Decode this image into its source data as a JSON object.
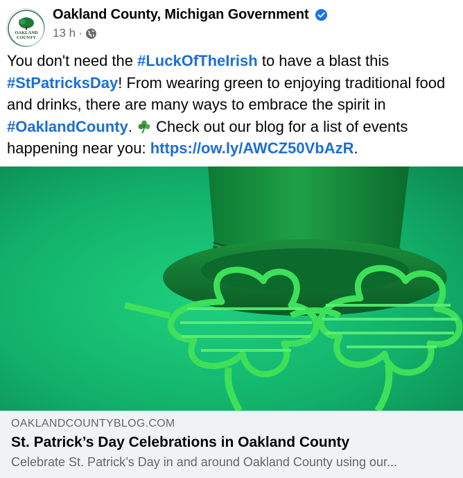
{
  "post": {
    "author": "Oakland County, Michigan Government",
    "timestamp": "13 h",
    "separator": "·",
    "text": {
      "p1": "You don't need the ",
      "hashtag1": "#LuckOfTheIrish",
      "p2": " to have a blast this ",
      "hashtag2": "#StPatricksDay",
      "p3": "! From wearing green to enjoying traditional food and drinks, there are many ways to embrace the spirit in ",
      "hashtag3": "#OaklandCounty",
      "p4": ". ",
      "p5": " Check out our blog for a list of events happening near you: ",
      "link": "https://ow.ly/AWCZ50VbAzR",
      "p6": "."
    },
    "icons": {
      "verified": "verified-badge-icon",
      "audience": "globe-icon",
      "emoji": "shamrock-emoji"
    },
    "logo_text": [
      "OAKLAND",
      "COUNTY"
    ]
  },
  "link_preview": {
    "domain": "OAKLANDCOUNTYBLOG.COM",
    "title": "St. Patrick’s Day Celebrations in Oakland County",
    "description": "Celebrate St. Patrick’s Day in and around Oakland County using our..."
  },
  "colors": {
    "hashtag": "#1a6fd6",
    "verified": "#1b74e4",
    "preview_bg": "#f0f2f5",
    "image_bg": "#14b06a"
  }
}
